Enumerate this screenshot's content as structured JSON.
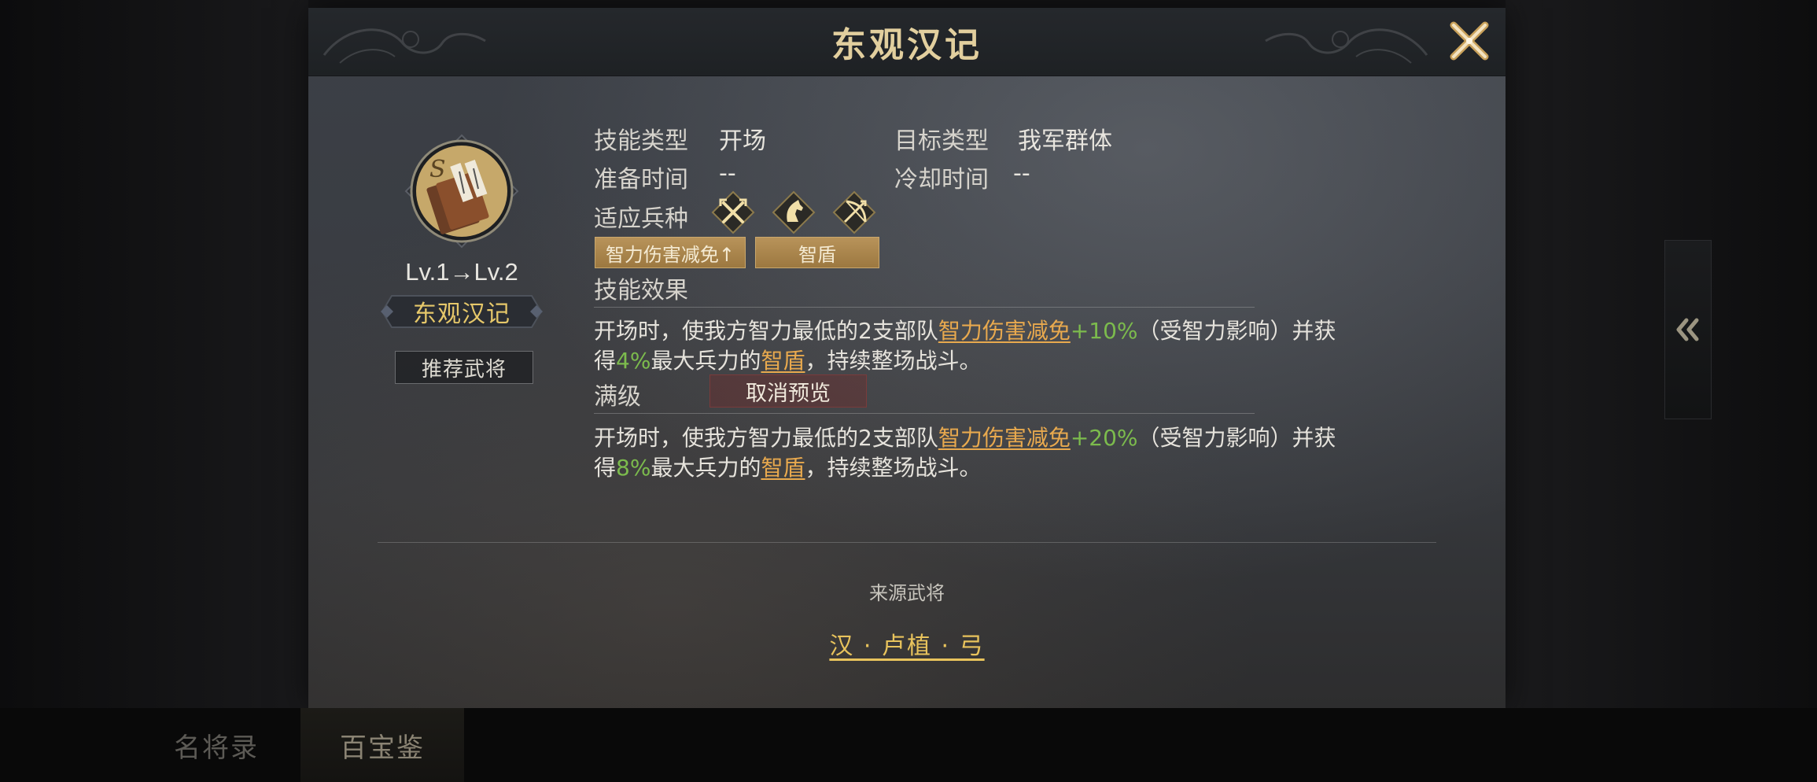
{
  "dialog": {
    "title": "东观汉记"
  },
  "skill": {
    "grade": "S",
    "level_text": "Lv.1→Lv.2",
    "name": "东观汉记",
    "recommend_label": "推荐武将"
  },
  "info": {
    "type_label": "技能类型",
    "type_value": "开场",
    "target_label": "目标类型",
    "target_value": "我军群体",
    "prep_label": "准备时间",
    "prep_value": "--",
    "cooldown_label": "冷却时间",
    "cooldown_value": "--",
    "troop_label": "适应兵种",
    "troops": [
      "spear-icon",
      "cavalry-icon",
      "archer-icon"
    ]
  },
  "tags": [
    "智力伤害减免↑",
    "智盾"
  ],
  "effect": {
    "title": "技能效果",
    "current": {
      "line1_a": "开场时，使我方智力最低的2支部队",
      "line1_kw": "智力伤害减免",
      "line1_val": "+10%",
      "line1_b": "（受智力影响）并获",
      "line2_a": "得",
      "line2_val": "4%",
      "line2_b": "最大兵力的",
      "line2_kw": "智盾",
      "line2_c": "，持续整场战斗。"
    },
    "max_label": "满级",
    "cancel_preview_label": "取消预览",
    "max": {
      "line1_a": "开场时，使我方智力最低的2支部队",
      "line1_kw": "智力伤害减免",
      "line1_val": "+20%",
      "line1_b": "（受智力影响）并获",
      "line2_a": "得",
      "line2_val": "8%",
      "line2_b": "最大兵力的",
      "line2_kw": "智盾",
      "line2_c": "，持续整场战斗。"
    }
  },
  "source": {
    "title": "来源武将",
    "general": "汉 · 卢植 · 弓"
  },
  "tabs": [
    "名将录",
    "百宝鉴"
  ],
  "colors": {
    "gold": "#e6c86a",
    "keyword": "#e8a94e",
    "value_green": "#7cbb4d"
  }
}
